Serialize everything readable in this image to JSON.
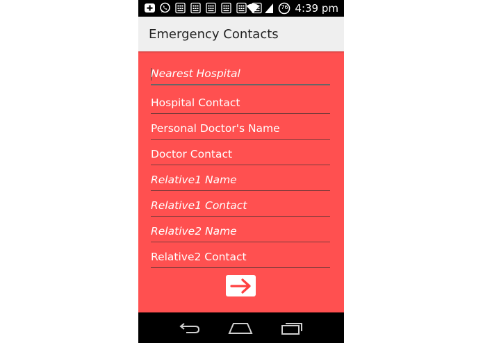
{
  "status_bar": {
    "time": "4:39 pm",
    "battery_level": "76",
    "notification_icons": [
      "add-icon",
      "whatsapp-icon",
      "app-icon",
      "app-icon",
      "app-icon",
      "app-icon",
      "app-icon",
      "app-icon"
    ]
  },
  "action_bar": {
    "title": "Emergency Contacts"
  },
  "form": {
    "fields": [
      {
        "placeholder": "Nearest Hospital",
        "value": ""
      },
      {
        "placeholder": "",
        "value": "Hospital Contact"
      },
      {
        "placeholder": "",
        "value": "Personal Doctor's Name"
      },
      {
        "placeholder": "",
        "value": "Doctor Contact"
      },
      {
        "placeholder": "Relative1 Name",
        "value": ""
      },
      {
        "placeholder": "Relative1 Contact",
        "value": ""
      },
      {
        "placeholder": "Relative2 Name",
        "value": ""
      },
      {
        "placeholder": "",
        "value": "Relative2 Contact"
      }
    ],
    "next_button_icon": "arrow-right-icon"
  },
  "colors": {
    "background": "#ff5050",
    "action_bar": "#efefef",
    "arrow": "#ff4040"
  }
}
